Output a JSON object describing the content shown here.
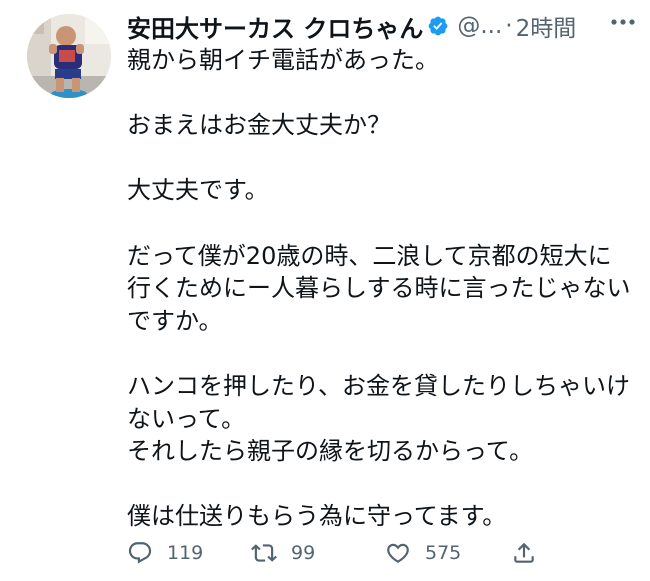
{
  "tweet": {
    "author_name": "安田大サーカス クロちゃん",
    "handle": "@...",
    "separator": "·",
    "time": "2時間",
    "text": "親から朝イチ電話があった。\n\nおまえはお金大丈夫か？\n\n大丈夫です。\n\nだって僕が20歳の時、二浪して京都の短大に\n行くためにー人暮らしする時に言ったじゃない\nですか。\n\nハンコを押したり、お金を貸したりしちゃいけ\nないって。\nそれしたら親子の縁を切るからって。\n\n僕は仕送りもらう為に守ってます。",
    "verified_color": "#1d9bf0"
  },
  "actions": {
    "reply": {
      "icon": "reply-icon",
      "count": "119"
    },
    "retweet": {
      "icon": "retweet-icon",
      "count": "99"
    },
    "like": {
      "icon": "heart-icon",
      "count": "575"
    },
    "share": {
      "icon": "share-icon"
    }
  }
}
